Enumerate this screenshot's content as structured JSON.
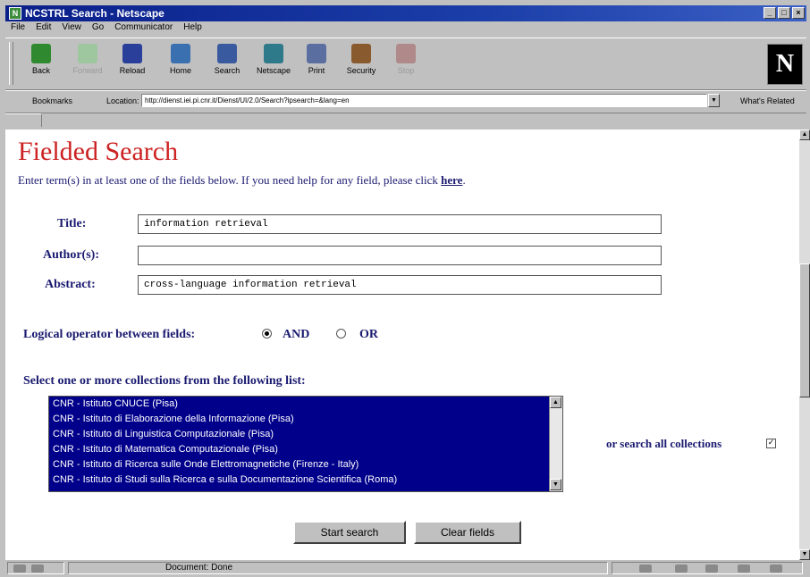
{
  "window": {
    "title": "NCSTRL Search - Netscape"
  },
  "menu": [
    "File",
    "Edit",
    "View",
    "Go",
    "Communicator",
    "Help"
  ],
  "toolbar": {
    "buttons": [
      {
        "label": "Back",
        "icon": "back-arrow-icon",
        "color": "#2f8a2f",
        "disabled": false
      },
      {
        "label": "Forward",
        "icon": "forward-arrow-icon",
        "color": "#9fc79f",
        "disabled": true
      },
      {
        "label": "Reload",
        "icon": "reload-icon",
        "color": "#2a3f9a",
        "disabled": false
      },
      {
        "label": "Home",
        "icon": "home-icon",
        "color": "#3a6fb0",
        "disabled": false
      },
      {
        "label": "Search",
        "icon": "search-icon",
        "color": "#3a5aa0",
        "disabled": false
      },
      {
        "label": "Netscape",
        "icon": "netscape-icon",
        "color": "#2f7a8a",
        "disabled": false
      },
      {
        "label": "Print",
        "icon": "print-icon",
        "color": "#5a6fa0",
        "disabled": false
      },
      {
        "label": "Security",
        "icon": "lock-icon",
        "color": "#8a5a2f",
        "disabled": false
      },
      {
        "label": "Stop",
        "icon": "stop-icon",
        "color": "#b08a8a",
        "disabled": true
      }
    ]
  },
  "location": {
    "bookmarks_label": "Bookmarks",
    "label": "Location:",
    "url": "http://dienst.iei.pi.cnr.it/Dienst/UI/2.0/Search?ipsearch=&lang=en",
    "related_label": "What's Related"
  },
  "page": {
    "title": "Fielded Search",
    "intro_text": "Enter term(s) in at least one of the fields below. If you need help for any field, please click ",
    "help_link": "here",
    "intro_end": ".",
    "fields": [
      {
        "label": "Title:",
        "value": "information retrieval"
      },
      {
        "label": "Author(s):",
        "value": ""
      },
      {
        "label": "Abstract:",
        "value": "cross-language information retrieval"
      }
    ],
    "logical_label": "Logical operator between fields:",
    "op_and": "AND",
    "op_or": "OR",
    "collections_label": "Select one or more collections from the following list:",
    "collections": [
      "CNR - Istituto CNUCE (Pisa)",
      "CNR - Istituto di Elaborazione della Informazione (Pisa)",
      "CNR - Istituto di Linguistica Computazionale (Pisa)",
      "CNR - Istituto di Matematica Computazionale (Pisa)",
      "CNR - Istituto di Ricerca sulle Onde Elettromagnetiche (Firenze - Italy)",
      "CNR - Istituto di Studi sulla Ricerca e sulla Documentazione Scientifica (Roma)"
    ],
    "all_collections_label": "or search all collections",
    "start_button": "Start search",
    "clear_button": "Clear fields"
  },
  "status": {
    "text": "Document: Done"
  }
}
